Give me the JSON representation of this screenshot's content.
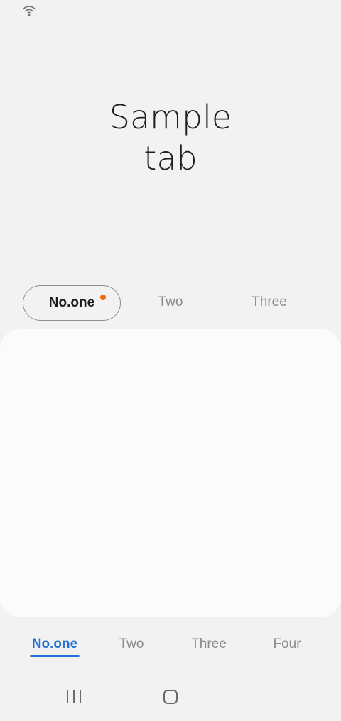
{
  "status_bar": {
    "icons": [
      "wifi-icon"
    ]
  },
  "title": {
    "line1": "Sample",
    "line2": "tab"
  },
  "top_tabs": [
    {
      "label": "No.one",
      "selected": true,
      "badge": true
    },
    {
      "label": "Two",
      "selected": false
    },
    {
      "label": "Three",
      "selected": false
    }
  ],
  "bottom_tabs": [
    {
      "label": "No.one",
      "selected": true
    },
    {
      "label": "Two",
      "selected": false
    },
    {
      "label": "Three",
      "selected": false
    },
    {
      "label": "Four",
      "selected": false
    }
  ],
  "nav_bar": {
    "icons": [
      "recent-apps-icon",
      "home-icon"
    ]
  },
  "colors": {
    "background": "#f2f2f2",
    "card": "#fbfbfb",
    "accent_blue": "#2371d7",
    "badge_orange": "#f2670f",
    "inactive_text": "#8a8a8a"
  }
}
